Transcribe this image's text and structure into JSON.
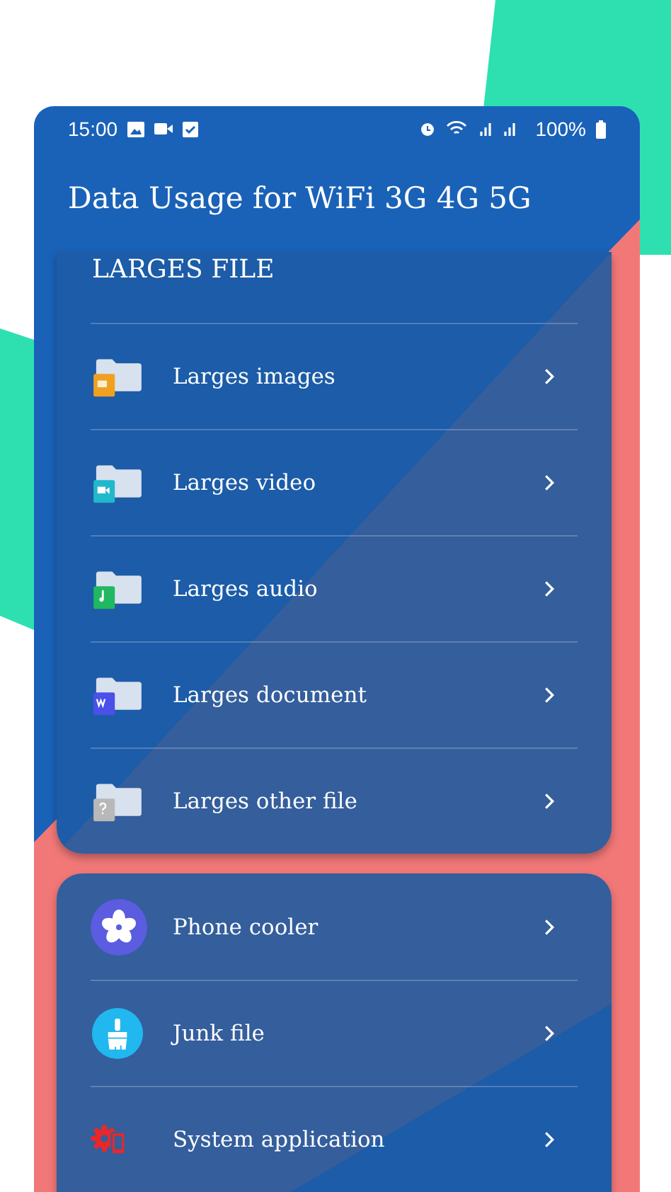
{
  "status_bar": {
    "time": "15:00",
    "battery": "100%"
  },
  "app_bar": {
    "title": "Data Usage for WiFi 3G 4G 5G"
  },
  "large_files": {
    "heading": "LARGES FILE",
    "items": [
      {
        "label": "Larges images",
        "kind": "images"
      },
      {
        "label": "Larges video",
        "kind": "video"
      },
      {
        "label": "Larges audio",
        "kind": "audio"
      },
      {
        "label": "Larges document",
        "kind": "document"
      },
      {
        "label": "Larges other file",
        "kind": "other"
      }
    ]
  },
  "tools": {
    "items": [
      {
        "label": "Phone cooler",
        "kind": "cooler"
      },
      {
        "label": "Junk file",
        "kind": "junk"
      },
      {
        "label": "System application",
        "kind": "system"
      }
    ]
  }
}
